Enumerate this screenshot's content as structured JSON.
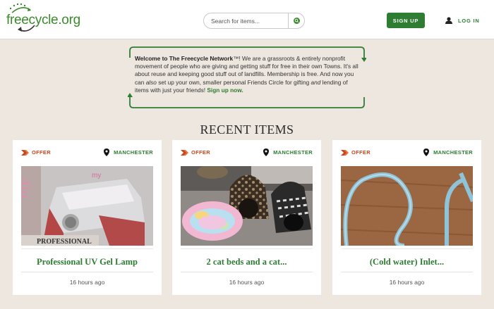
{
  "header": {
    "logo_text": "freecycle.org",
    "search_placeholder": "Search for items...",
    "signup_label": "SIGN UP",
    "login_label": "LOG IN"
  },
  "welcome": {
    "bold_lead": "Welcome to The Freecycle Network",
    "tm": "™",
    "text1": "! We are a grassroots & entirely nonprofit movement of people who are giving and getting stuff for free in their own Towns. It's all about reuse and keeping good stuff out of landfills. Membership is free. And now you can ",
    "also": "also",
    "text2": " set up your own, smaller personal Friends Circle for gifting ",
    "and": "and",
    "text3": " lending of items with just your friends! ",
    "signup_link": "Sign up now."
  },
  "section_title": "RECENT ITEMS",
  "items": [
    {
      "type": "OFFER",
      "location": "MANCHESTER",
      "title": "Professional UV Gel Lamp",
      "time": "16 hours ago",
      "image_caption": "PROFESSIONAL"
    },
    {
      "type": "OFFER",
      "location": "MANCHESTER",
      "title": "2 cat beds and a cat...",
      "time": "16 hours ago"
    },
    {
      "type": "OFFER",
      "location": "MANCHESTER",
      "title": "(Cold water) Inlet...",
      "time": "16 hours ago"
    }
  ],
  "colors": {
    "brand_green": "#2e7d32",
    "offer_orange": "#c8461c",
    "background": "#ede7df"
  },
  "icons": [
    "search-icon",
    "user-icon",
    "offer-arrow-icon",
    "location-pin-icon"
  ]
}
